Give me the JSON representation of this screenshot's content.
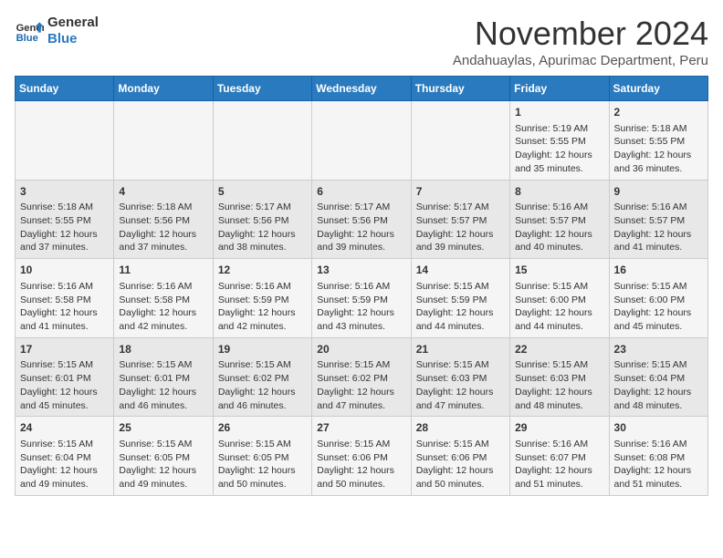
{
  "logo": {
    "line1": "General",
    "line2": "Blue"
  },
  "title": "November 2024",
  "subtitle": "Andahuaylas, Apurimac Department, Peru",
  "weekdays": [
    "Sunday",
    "Monday",
    "Tuesday",
    "Wednesday",
    "Thursday",
    "Friday",
    "Saturday"
  ],
  "weeks": [
    [
      {
        "day": "",
        "info": ""
      },
      {
        "day": "",
        "info": ""
      },
      {
        "day": "",
        "info": ""
      },
      {
        "day": "",
        "info": ""
      },
      {
        "day": "",
        "info": ""
      },
      {
        "day": "1",
        "info": "Sunrise: 5:19 AM\nSunset: 5:55 PM\nDaylight: 12 hours and 35 minutes."
      },
      {
        "day": "2",
        "info": "Sunrise: 5:18 AM\nSunset: 5:55 PM\nDaylight: 12 hours and 36 minutes."
      }
    ],
    [
      {
        "day": "3",
        "info": "Sunrise: 5:18 AM\nSunset: 5:55 PM\nDaylight: 12 hours and 37 minutes."
      },
      {
        "day": "4",
        "info": "Sunrise: 5:18 AM\nSunset: 5:56 PM\nDaylight: 12 hours and 37 minutes."
      },
      {
        "day": "5",
        "info": "Sunrise: 5:17 AM\nSunset: 5:56 PM\nDaylight: 12 hours and 38 minutes."
      },
      {
        "day": "6",
        "info": "Sunrise: 5:17 AM\nSunset: 5:56 PM\nDaylight: 12 hours and 39 minutes."
      },
      {
        "day": "7",
        "info": "Sunrise: 5:17 AM\nSunset: 5:57 PM\nDaylight: 12 hours and 39 minutes."
      },
      {
        "day": "8",
        "info": "Sunrise: 5:16 AM\nSunset: 5:57 PM\nDaylight: 12 hours and 40 minutes."
      },
      {
        "day": "9",
        "info": "Sunrise: 5:16 AM\nSunset: 5:57 PM\nDaylight: 12 hours and 41 minutes."
      }
    ],
    [
      {
        "day": "10",
        "info": "Sunrise: 5:16 AM\nSunset: 5:58 PM\nDaylight: 12 hours and 41 minutes."
      },
      {
        "day": "11",
        "info": "Sunrise: 5:16 AM\nSunset: 5:58 PM\nDaylight: 12 hours and 42 minutes."
      },
      {
        "day": "12",
        "info": "Sunrise: 5:16 AM\nSunset: 5:59 PM\nDaylight: 12 hours and 42 minutes."
      },
      {
        "day": "13",
        "info": "Sunrise: 5:16 AM\nSunset: 5:59 PM\nDaylight: 12 hours and 43 minutes."
      },
      {
        "day": "14",
        "info": "Sunrise: 5:15 AM\nSunset: 5:59 PM\nDaylight: 12 hours and 44 minutes."
      },
      {
        "day": "15",
        "info": "Sunrise: 5:15 AM\nSunset: 6:00 PM\nDaylight: 12 hours and 44 minutes."
      },
      {
        "day": "16",
        "info": "Sunrise: 5:15 AM\nSunset: 6:00 PM\nDaylight: 12 hours and 45 minutes."
      }
    ],
    [
      {
        "day": "17",
        "info": "Sunrise: 5:15 AM\nSunset: 6:01 PM\nDaylight: 12 hours and 45 minutes."
      },
      {
        "day": "18",
        "info": "Sunrise: 5:15 AM\nSunset: 6:01 PM\nDaylight: 12 hours and 46 minutes."
      },
      {
        "day": "19",
        "info": "Sunrise: 5:15 AM\nSunset: 6:02 PM\nDaylight: 12 hours and 46 minutes."
      },
      {
        "day": "20",
        "info": "Sunrise: 5:15 AM\nSunset: 6:02 PM\nDaylight: 12 hours and 47 minutes."
      },
      {
        "day": "21",
        "info": "Sunrise: 5:15 AM\nSunset: 6:03 PM\nDaylight: 12 hours and 47 minutes."
      },
      {
        "day": "22",
        "info": "Sunrise: 5:15 AM\nSunset: 6:03 PM\nDaylight: 12 hours and 48 minutes."
      },
      {
        "day": "23",
        "info": "Sunrise: 5:15 AM\nSunset: 6:04 PM\nDaylight: 12 hours and 48 minutes."
      }
    ],
    [
      {
        "day": "24",
        "info": "Sunrise: 5:15 AM\nSunset: 6:04 PM\nDaylight: 12 hours and 49 minutes."
      },
      {
        "day": "25",
        "info": "Sunrise: 5:15 AM\nSunset: 6:05 PM\nDaylight: 12 hours and 49 minutes."
      },
      {
        "day": "26",
        "info": "Sunrise: 5:15 AM\nSunset: 6:05 PM\nDaylight: 12 hours and 50 minutes."
      },
      {
        "day": "27",
        "info": "Sunrise: 5:15 AM\nSunset: 6:06 PM\nDaylight: 12 hours and 50 minutes."
      },
      {
        "day": "28",
        "info": "Sunrise: 5:15 AM\nSunset: 6:06 PM\nDaylight: 12 hours and 50 minutes."
      },
      {
        "day": "29",
        "info": "Sunrise: 5:16 AM\nSunset: 6:07 PM\nDaylight: 12 hours and 51 minutes."
      },
      {
        "day": "30",
        "info": "Sunrise: 5:16 AM\nSunset: 6:08 PM\nDaylight: 12 hours and 51 minutes."
      }
    ]
  ]
}
